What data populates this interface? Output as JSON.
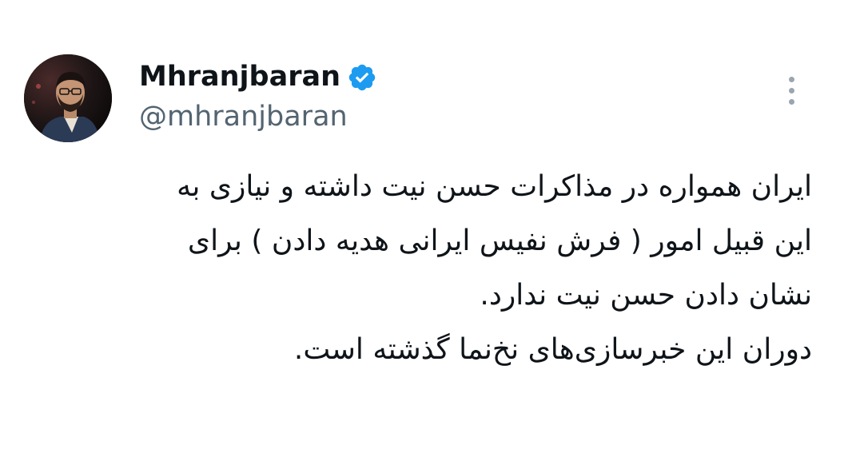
{
  "author": {
    "display_name": "Mhranjbaran",
    "handle": "@mhranjbaran",
    "verified": true,
    "verified_color": "#1d9bf0",
    "avatar_icon": "profile-photo"
  },
  "menu": {
    "icon": "more-vertical-icon"
  },
  "tweet": {
    "lines": [
      "ایران همواره در مذاکرات حسن نیت داشته و نیازی به",
      "این قبیل امور ( فرش نفیس ایرانی هدیه دادن ) برای",
      "نشان دادن حسن نیت ندارد.",
      "دوران این خبرسازی‌های نخ‌نما گذشته است."
    ]
  },
  "colors": {
    "text_primary": "#0f1419",
    "text_secondary": "#536471",
    "background": "#ffffff"
  }
}
